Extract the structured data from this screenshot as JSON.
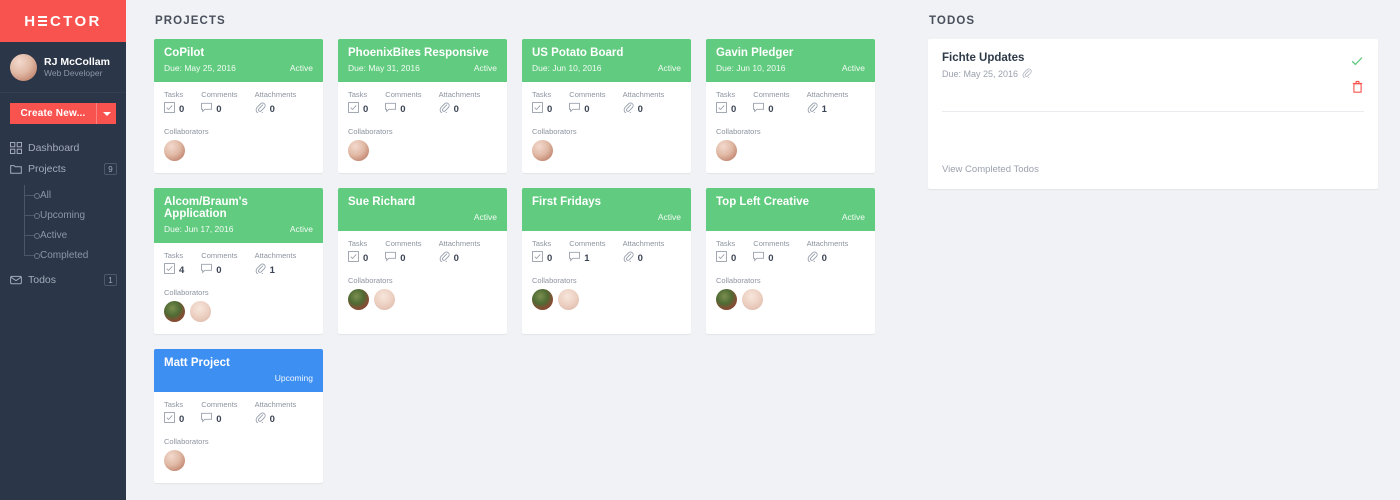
{
  "brand": {
    "logo_text_before": "H",
    "logo_text_after": "CTOR",
    "logo_color": "#f9534f"
  },
  "sidebar": {
    "user": {
      "name": "RJ McCollam",
      "role": "Web Developer"
    },
    "create_button": {
      "label": "Create New...",
      "caret": "chevron-down"
    },
    "nav": [
      {
        "label": "Dashboard",
        "icon": "grid-icon",
        "badge": null
      },
      {
        "label": "Projects",
        "icon": "folder-icon",
        "badge": "9"
      }
    ],
    "subnav": [
      {
        "label": "All"
      },
      {
        "label": "Upcoming"
      },
      {
        "label": "Active"
      },
      {
        "label": "Completed"
      }
    ],
    "nav_bottom": [
      {
        "label": "Todos",
        "icon": "inbox-icon",
        "badge": "1"
      }
    ]
  },
  "projects": {
    "title": "PROJECTS",
    "stat_labels": {
      "tasks": "Tasks",
      "comments": "Comments",
      "attachments": "Attachments"
    },
    "collaborators_label": "Collaborators",
    "items": [
      {
        "name": "CoPilot",
        "due": "Due: May 25, 2016",
        "status": "Active",
        "color": "green",
        "tasks": "0",
        "comments": "0",
        "attachments": "0",
        "collaborators": [
          "a1"
        ]
      },
      {
        "name": "PhoenixBites Responsive",
        "due": "Due: May 31, 2016",
        "status": "Active",
        "color": "green",
        "tasks": "0",
        "comments": "0",
        "attachments": "0",
        "collaborators": [
          "a1"
        ]
      },
      {
        "name": "US Potato Board",
        "due": "Due: Jun 10, 2016",
        "status": "Active",
        "color": "green",
        "tasks": "0",
        "comments": "0",
        "attachments": "0",
        "collaborators": [
          "a1"
        ]
      },
      {
        "name": "Gavin Pledger",
        "due": "Due: Jun 10, 2016",
        "status": "Active",
        "color": "green",
        "tasks": "0",
        "comments": "0",
        "attachments": "1",
        "collaborators": [
          "a1"
        ]
      },
      {
        "name": "Alcom/Braum's Application",
        "due": "Due: Jun 17, 2016",
        "status": "Active",
        "color": "green",
        "tasks": "4",
        "comments": "0",
        "attachments": "1",
        "collaborators": [
          "a2",
          "a3"
        ]
      },
      {
        "name": "Sue Richard",
        "due": "",
        "status": "Active",
        "color": "green",
        "tasks": "0",
        "comments": "0",
        "attachments": "0",
        "collaborators": [
          "a2",
          "a3"
        ]
      },
      {
        "name": "First Fridays",
        "due": "",
        "status": "Active",
        "color": "green",
        "tasks": "0",
        "comments": "1",
        "attachments": "0",
        "collaborators": [
          "a2",
          "a3"
        ]
      },
      {
        "name": "Top Left Creative",
        "due": "",
        "status": "Active",
        "color": "green",
        "tasks": "0",
        "comments": "0",
        "attachments": "0",
        "collaborators": [
          "a2",
          "a3"
        ]
      },
      {
        "name": "Matt Project",
        "due": "",
        "status": "Upcoming",
        "color": "blue",
        "tasks": "0",
        "comments": "0",
        "attachments": "0",
        "collaborators": [
          "a1"
        ]
      }
    ]
  },
  "todos": {
    "title": "TODOS",
    "items": [
      {
        "title": "Fichte Updates",
        "due": "Due: May 25, 2016",
        "has_attachment": true
      }
    ],
    "view_completed_label": "View Completed Todos",
    "complete_icon": "check-icon",
    "delete_icon": "trash-icon",
    "complete_color": "#5fcb7f",
    "delete_color": "#f9534f"
  }
}
